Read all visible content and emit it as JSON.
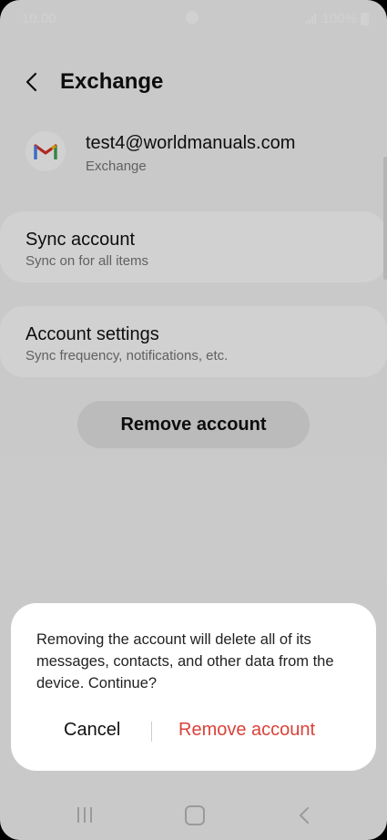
{
  "status_bar": {
    "time": "10.00",
    "battery": "100%"
  },
  "header": {
    "title": "Exchange"
  },
  "account": {
    "email": "test4@worldmanuals.com",
    "type": "Exchange"
  },
  "cards": [
    {
      "title": "Sync account",
      "subtitle": "Sync on for all items"
    },
    {
      "title": "Account settings",
      "subtitle": "Sync frequency, notifications, etc."
    }
  ],
  "remove_button_label": "Remove account",
  "dialog": {
    "message": "Removing the account will delete all of its messages, contacts, and other data from the device. Continue?",
    "cancel_label": "Cancel",
    "confirm_label": "Remove account"
  },
  "colors": {
    "destructive": "#d9433a",
    "background": "#f6f6f6",
    "scrim_overlay": "rgba(0,0,0,0.18)"
  },
  "icons": {
    "back": "chevron-left-icon",
    "account": "gmail-icon"
  }
}
